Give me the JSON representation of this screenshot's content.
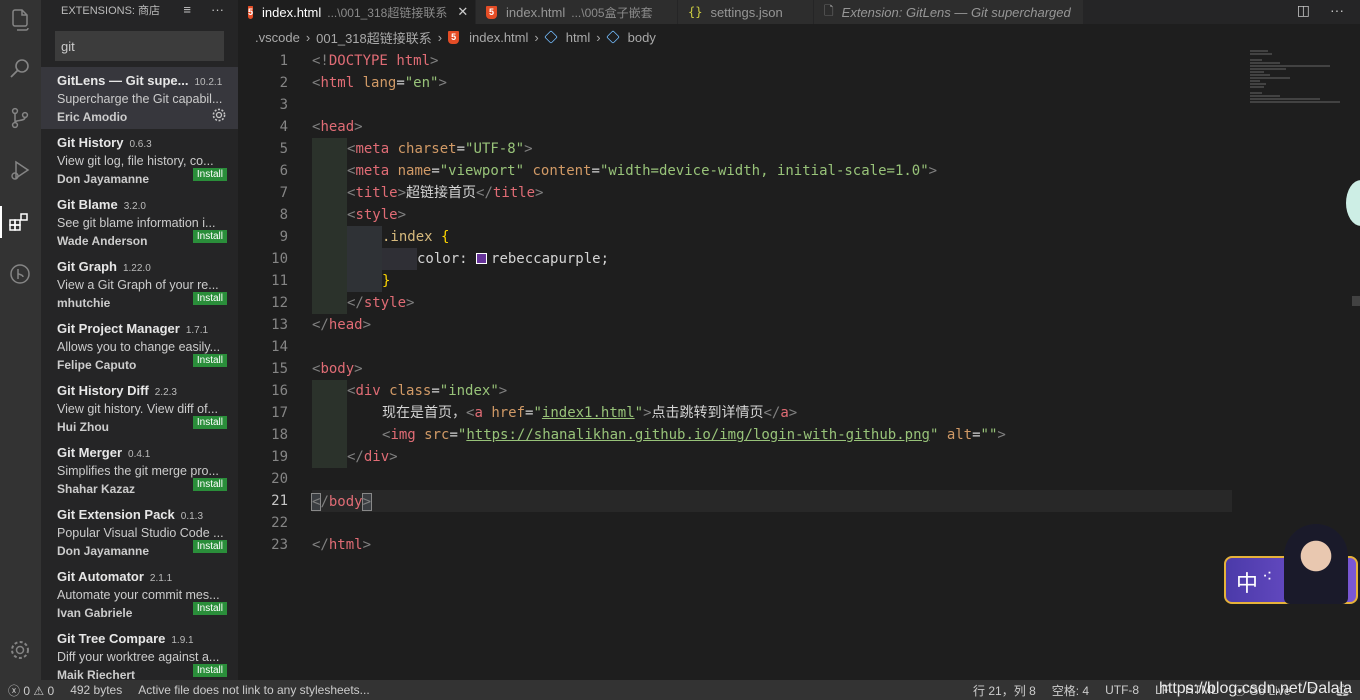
{
  "activity_bar": {
    "icons": [
      "explorer-icon",
      "search-icon",
      "source-control-icon",
      "run-debug-icon",
      "extensions-icon",
      "git-graph-icon",
      "settings-gear-icon"
    ]
  },
  "sidebar": {
    "title": "EXTENSIONS: 商店",
    "search_value": "git",
    "extensions": [
      {
        "name": "GitLens — Git supe...",
        "version": "10.2.1",
        "description": "Supercharge the Git capabil...",
        "author": "Eric Amodio",
        "action": "",
        "selected": true
      },
      {
        "name": "Git History",
        "version": "0.6.3",
        "description": "View git log, file history, co...",
        "author": "Don Jayamanne",
        "action": "Install"
      },
      {
        "name": "Git Blame",
        "version": "3.2.0",
        "description": "See git blame information i...",
        "author": "Wade Anderson",
        "action": "Install"
      },
      {
        "name": "Git Graph",
        "version": "1.22.0",
        "description": "View a Git Graph of your re...",
        "author": "mhutchie",
        "action": "Install"
      },
      {
        "name": "Git Project Manager",
        "version": "1.7.1",
        "description": "Allows you to change easily...",
        "author": "Felipe Caputo",
        "action": "Install"
      },
      {
        "name": "Git History Diff",
        "version": "2.2.3",
        "description": "View git history. View diff of...",
        "author": "Hui Zhou",
        "action": "Install"
      },
      {
        "name": "Git Merger",
        "version": "0.4.1",
        "description": "Simplifies the git merge pro...",
        "author": "Shahar Kazaz",
        "action": "Install"
      },
      {
        "name": "Git Extension Pack",
        "version": "0.1.3",
        "description": "Popular Visual Studio Code ...",
        "author": "Don Jayamanne",
        "action": "Install"
      },
      {
        "name": "Git Automator",
        "version": "2.1.1",
        "description": "Automate your commit mes...",
        "author": "Ivan Gabriele",
        "action": "Install"
      },
      {
        "name": "Git Tree Compare",
        "version": "1.9.1",
        "description": "Diff your worktree against a...",
        "author": "Maik Riechert",
        "action": "Install"
      }
    ]
  },
  "tabs": [
    {
      "label": "index.html",
      "sub": "...\\001_318超链接联系",
      "icon": "html5-icon",
      "active": true,
      "close": "✕"
    },
    {
      "label": "index.html",
      "sub": "...\\005盒子嵌套",
      "icon": "html5-icon",
      "active": false
    },
    {
      "label": "settings.json",
      "sub": "",
      "icon": "json-icon",
      "active": false
    },
    {
      "label": "Extension: GitLens — Git supercharged",
      "sub": "",
      "icon": "preview-icon",
      "active": false
    }
  ],
  "breadcrumb": [
    ".vscode",
    "001_318超链接联系",
    "index.html",
    "html",
    "body"
  ],
  "editor": {
    "line_numbers": [
      "1",
      "2",
      "3",
      "4",
      "5",
      "6",
      "7",
      "8",
      "9",
      "10",
      "11",
      "12",
      "13",
      "14",
      "15",
      "16",
      "17",
      "18",
      "19",
      "20",
      "21",
      "22",
      "23"
    ],
    "current_line": 21
  },
  "code_text": {
    "l1_doctype": "DOCTYPE",
    "l1_html": "html",
    "l2_tag": "html",
    "l2_attr": "lang",
    "l2_val": "\"en\"",
    "head": "head",
    "meta": "meta",
    "charset": "charset",
    "charset_val": "\"UTF-8\"",
    "name": "name",
    "name_val": "\"viewport\"",
    "content": "content",
    "content_val": "\"width=device-width, initial-scale=1.0\"",
    "title": "title",
    "title_text": "超链接首页",
    "style": "style",
    "selector": ".index",
    "brace_open": "{",
    "brace_close": "}",
    "prop": "color:",
    "prop_val": "rebeccapurple;",
    "body": "body",
    "div": "div",
    "class": "class",
    "class_val": "\"index\"",
    "l17_text1": "现在是首页，",
    "a": "a",
    "href": "href",
    "href_val": "index1.html",
    "l17_text2": "点击跳转到详情页",
    "img": "img",
    "src": "src",
    "src_val": "https://shanalikhan.github.io/img/login-with-github.png",
    "alt": "alt",
    "alt_val": "\"\""
  },
  "statusbar": {
    "errors": "0",
    "warnings": "0",
    "size": "492 bytes",
    "message": "Active file does not link to any stylesheets...",
    "position": "行 21，列 8",
    "indent": "空格: 4",
    "encoding": "UTF-8",
    "eol": "LF",
    "language": "HTML",
    "golive": "Go Live"
  },
  "widget": {
    "char": "中"
  },
  "watermark": "https://blog.csdn.net/Dalala",
  "colors": {
    "accent": "#007acc",
    "install": "#2a8e3a",
    "tag": "#e06c75",
    "string": "#98c379",
    "attr": "#d19a66"
  }
}
